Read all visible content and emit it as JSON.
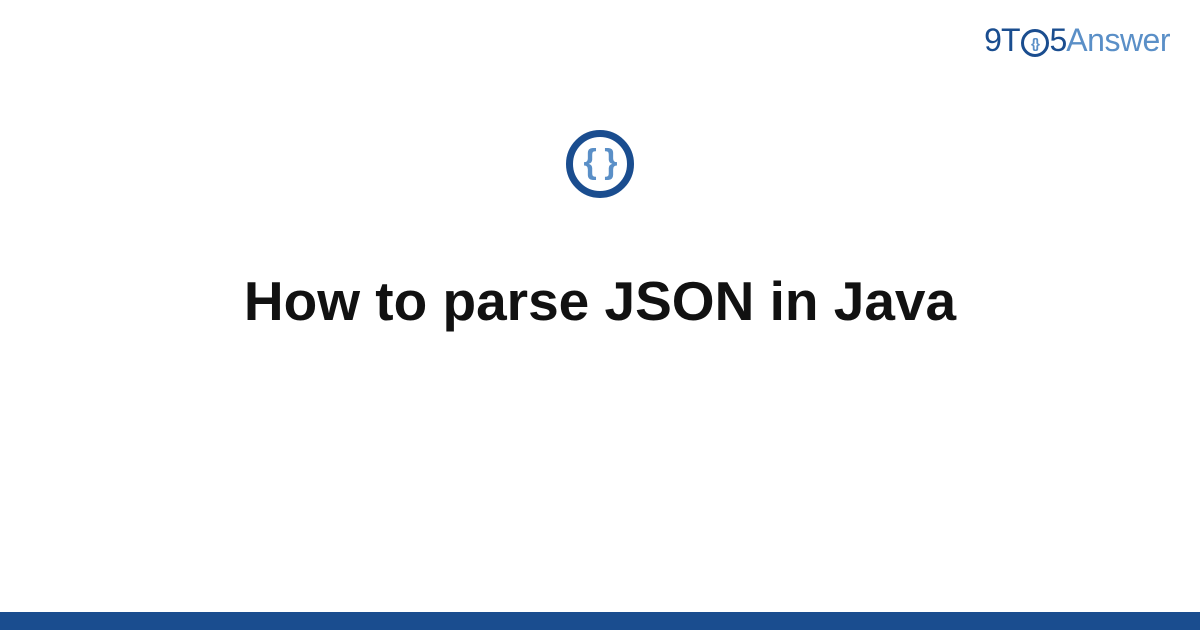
{
  "brand": {
    "part1": "9",
    "part2": "T",
    "o_inner": "{}",
    "part3": "5",
    "part4": "Answer"
  },
  "category": {
    "icon_glyph": "{ }",
    "icon_name": "json-braces-icon"
  },
  "title": "How to parse JSON in Java",
  "colors": {
    "brand_dark": "#1a4d8f",
    "brand_light": "#5a8fc7",
    "text": "#111111",
    "background": "#ffffff"
  }
}
